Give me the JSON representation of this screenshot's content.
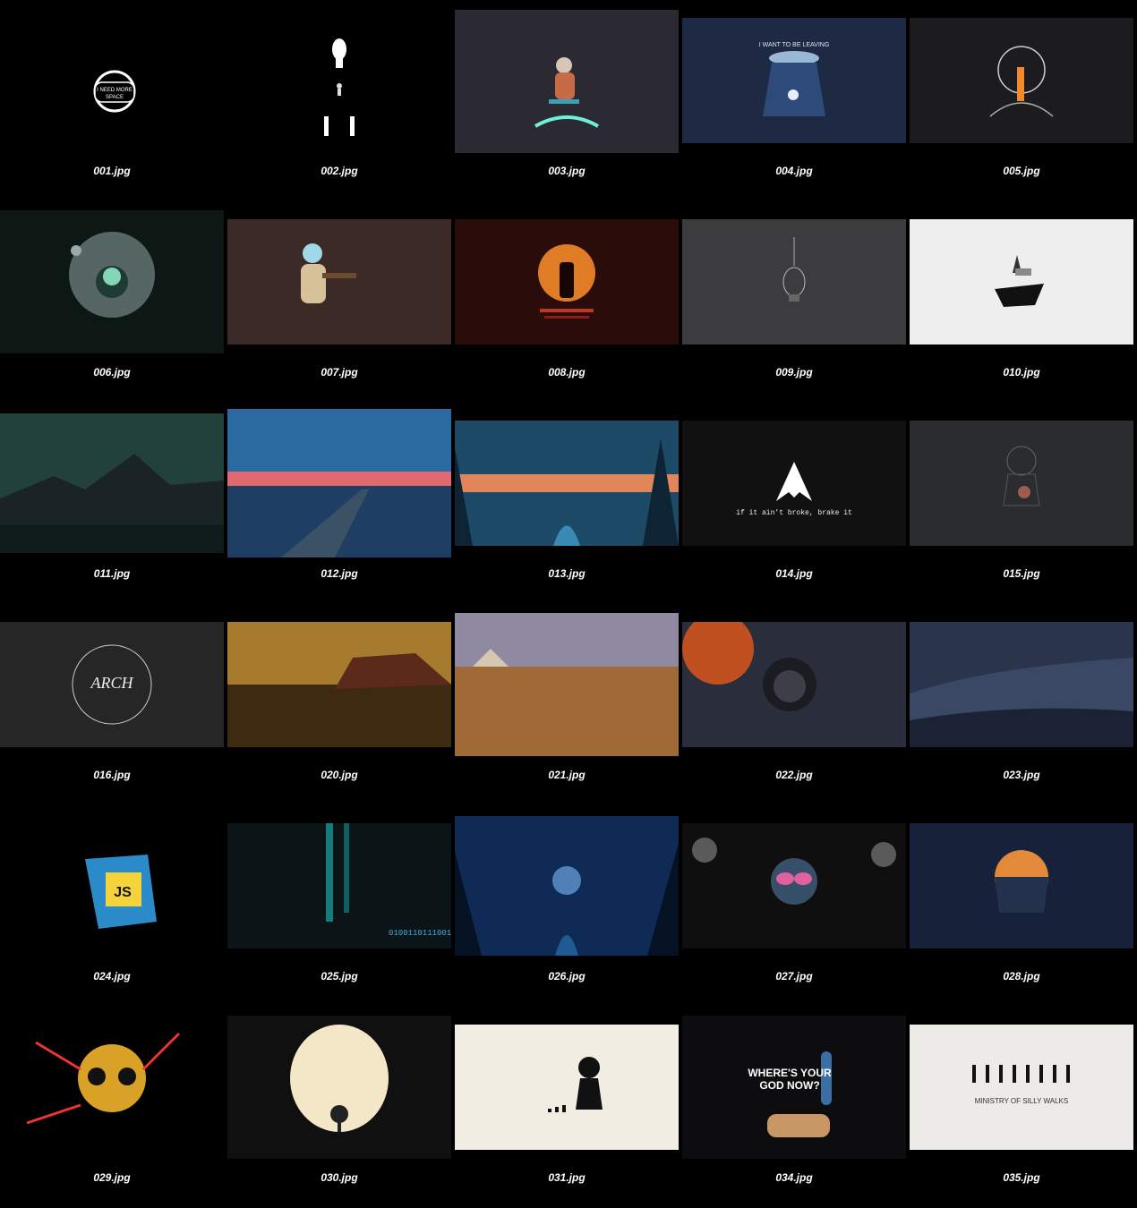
{
  "gallery": {
    "items": [
      {
        "filename": "001.jpg",
        "icon": "astronaut-helmet",
        "caption_overlay": "I NEED MORE SPACE",
        "bg": "#000000"
      },
      {
        "filename": "002.jpg",
        "icon": "skull-silhouette",
        "bg": "#000000"
      },
      {
        "filename": "003.jpg",
        "icon": "astronaut-skateboard",
        "bg": "#2b2a33"
      },
      {
        "filename": "004.jpg",
        "icon": "ufo-astronaut",
        "caption_overlay": "I WANT TO BE LEAVING",
        "bg": "#1e2a44"
      },
      {
        "filename": "005.jpg",
        "icon": "astronaut-rocket",
        "bg": "#1c1b1e"
      },
      {
        "filename": "006.jpg",
        "icon": "astronaut-planet",
        "bg": "#0d1714"
      },
      {
        "filename": "007.jpg",
        "icon": "astronaut-guitar",
        "bg": "#3b2a26"
      },
      {
        "filename": "008.jpg",
        "icon": "astronaut-sunset",
        "bg": "#2a0d0a"
      },
      {
        "filename": "009.jpg",
        "icon": "lightbulb",
        "bg": "#3c3c3f"
      },
      {
        "filename": "010.jpg",
        "icon": "floating-island",
        "bg": "#eeeeee"
      },
      {
        "filename": "011.jpg",
        "icon": "mountains",
        "bg": "#22413d"
      },
      {
        "filename": "012.jpg",
        "icon": "pier-sunset",
        "bg": "#2c5c8f"
      },
      {
        "filename": "013.jpg",
        "icon": "forest-river",
        "bg": "#1d4a66"
      },
      {
        "filename": "014.jpg",
        "icon": "arch-logo",
        "caption_overlay": "if it ain't broke, brake it",
        "bg": "#111111"
      },
      {
        "filename": "015.jpg",
        "icon": "astronaut-jellyfish",
        "bg": "#2a2c2f"
      },
      {
        "filename": "016.jpg",
        "icon": "arch-linux-badge",
        "caption_overlay": "ARCH",
        "bg": "#262626"
      },
      {
        "filename": "020.jpg",
        "icon": "stormy-sea-painting",
        "bg": "#6b4a1f"
      },
      {
        "filename": "021.jpg",
        "icon": "venice-painting",
        "bg": "#8c6a44"
      },
      {
        "filename": "022.jpg",
        "icon": "astronaut-portrait",
        "bg": "#2a2e3c"
      },
      {
        "filename": "023.jpg",
        "icon": "desert-dunes",
        "bg": "#2a344a"
      },
      {
        "filename": "024.jpg",
        "icon": "js-mug",
        "caption_overlay": "JS",
        "bg": "#000000"
      },
      {
        "filename": "025.jpg",
        "icon": "circuit-board",
        "bg": "#0b1416"
      },
      {
        "filename": "026.jpg",
        "icon": "night-forest",
        "bg": "#0f2a55"
      },
      {
        "filename": "027.jpg",
        "icon": "monkey-glasses",
        "bg": "#0f0f10"
      },
      {
        "filename": "028.jpg",
        "icon": "skull-landscape",
        "bg": "#18213a"
      },
      {
        "filename": "029.jpg",
        "icon": "paint-skull",
        "bg": "#000000"
      },
      {
        "filename": "030.jpg",
        "icon": "tree-silhouette",
        "bg": "#101010"
      },
      {
        "filename": "031.jpg",
        "icon": "cthulhu-evolution",
        "bg": "#f1ede2"
      },
      {
        "filename": "034.jpg",
        "icon": "toilet-paper",
        "caption_overlay": "WHERE'S YOUR GOD NOW?",
        "bg": "#0d0d0f"
      },
      {
        "filename": "035.jpg",
        "icon": "silly-walks",
        "caption_overlay": "MINISTRY OF SILLY WALKS",
        "bg": "#ecebe8"
      }
    ]
  }
}
